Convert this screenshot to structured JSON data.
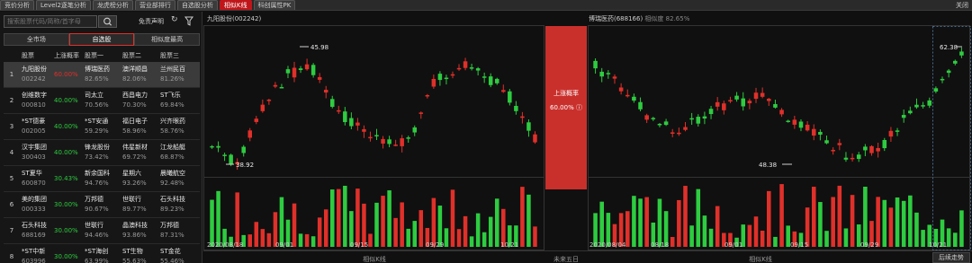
{
  "tabs": [
    "竞价分析",
    "Level2逐笔分析",
    "龙虎榜分析",
    "营业部排行",
    "自选股分析",
    "相似K线",
    "科创属性PK"
  ],
  "active_tab": 5,
  "close_label": "关闭",
  "search": {
    "placeholder": "搜索股票代码/简称/首字母"
  },
  "disclaimer": "免责声明",
  "segments": [
    "全市场",
    "自选股",
    "相似度最高"
  ],
  "active_segment": 1,
  "table": {
    "headers": [
      "股票",
      "上涨概率",
      "股票一",
      "股票二",
      "股票三"
    ],
    "rows": [
      {
        "idx": "1",
        "name": "九阳股份",
        "code": "002242",
        "prob": "60.00%",
        "s1": "博瑞医药",
        "s1v": "82.65%",
        "s2": "澳洋顺昌",
        "s2v": "82.06%",
        "s3": "兰州民百",
        "s3v": "81.26%"
      },
      {
        "idx": "2",
        "name": "创维数字",
        "code": "000810",
        "prob": "40.00%",
        "s1": "司太立",
        "s1v": "70.56%",
        "s2": "西昌电力",
        "s2v": "70.30%",
        "s3": "ST飞乐",
        "s3v": "69.84%"
      },
      {
        "idx": "3",
        "name": "*ST德豪",
        "code": "002005",
        "prob": "40.00%",
        "s1": "*ST安通",
        "s1v": "59.29%",
        "s2": "福日电子",
        "s2v": "58.96%",
        "s3": "兴齐眼药",
        "s3v": "58.76%"
      },
      {
        "idx": "4",
        "name": "汉宇集团",
        "code": "300403",
        "prob": "40.00%",
        "s1": "锋龙股份",
        "s1v": "73.42%",
        "s2": "伟星新材",
        "s2v": "69.72%",
        "s3": "江龙船艇",
        "s3v": "68.87%"
      },
      {
        "idx": "5",
        "name": "ST夏华",
        "code": "600870",
        "prob": "30.43%",
        "s1": "新余国科",
        "s1v": "94.76%",
        "s2": "星期六",
        "s2v": "93.26%",
        "s3": "晨曦航空",
        "s3v": "92.48%"
      },
      {
        "idx": "6",
        "name": "美的集团",
        "code": "000333",
        "prob": "30.00%",
        "s1": "万邦德",
        "s1v": "90.67%",
        "s2": "世联行",
        "s2v": "89.77%",
        "s3": "石头科技",
        "s3v": "89.23%"
      },
      {
        "idx": "7",
        "name": "石头科技",
        "code": "688169",
        "prob": "30.00%",
        "s1": "世联行",
        "s1v": "94.46%",
        "s2": "晶澳科技",
        "s2v": "93.86%",
        "s3": "万邦德",
        "s3v": "87.31%"
      },
      {
        "idx": "8",
        "name": "*ST中新",
        "code": "603996",
        "prob": "30.00%",
        "s1": "*ST海创",
        "s1v": "63.99%",
        "s2": "ST生物",
        "s2v": "55.63%",
        "s3": "ST金花",
        "s3v": "55.46%"
      }
    ]
  },
  "left_chart": {
    "title": "九阳股份(002242)",
    "high_label": "45.98",
    "low_label": "38.92",
    "x_labels": [
      "2020/08/18",
      "09/01",
      "09/15",
      "09/29",
      "10/21"
    ],
    "footer": "相似K线"
  },
  "middle": {
    "title": "上涨概率",
    "value": "60.00%",
    "footer": "未来五日"
  },
  "right_chart": {
    "title": "博瑞医药(688166)",
    "similarity_label": "相似度",
    "similarity_value": "82.65%",
    "high_label": "62.38",
    "low_label": "48.38",
    "x_labels": [
      "2020/08/04",
      "08/18",
      "09/01",
      "09/15",
      "09/29",
      "10/21"
    ],
    "footer": "相似K线",
    "after_button": "后续走势"
  },
  "colors": {
    "up": "#e0302a",
    "down": "#2ecc40",
    "accent": "#c0161a"
  }
}
